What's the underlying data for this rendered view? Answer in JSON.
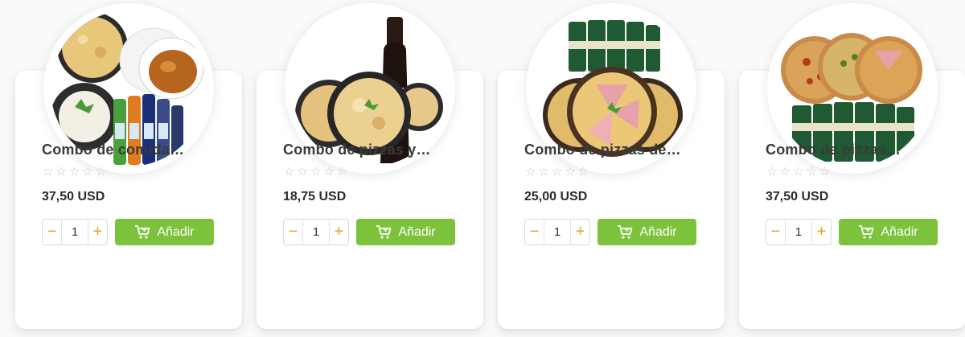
{
  "products": [
    {
      "title": "Combo de comida…",
      "price": "37,50 USD",
      "rating": 0,
      "stars": [
        "☆",
        "☆",
        "☆",
        "☆",
        "☆"
      ],
      "quantity": "1",
      "add_label": "Añadir",
      "decrement_label": "−",
      "increment_label": "+",
      "image_icon": "food-combo-drinks-image"
    },
    {
      "title": "Combo de pizzas y…",
      "price": "18,75 USD",
      "rating": 0,
      "stars": [
        "☆",
        "☆",
        "☆",
        "☆",
        "☆"
      ],
      "quantity": "1",
      "add_label": "Añadir",
      "decrement_label": "−",
      "increment_label": "+",
      "image_icon": "pizzas-wine-image"
    },
    {
      "title": "Combo de pizzas de…",
      "price": "25,00 USD",
      "rating": 0,
      "stars": [
        "☆",
        "☆",
        "☆",
        "☆",
        "☆"
      ],
      "quantity": "1",
      "add_label": "Añadir",
      "decrement_label": "−",
      "increment_label": "+",
      "image_icon": "ham-pizzas-beer-image"
    },
    {
      "title": "Combo de pizzas…",
      "price": "37,50 USD",
      "rating": 0,
      "stars": [
        "☆",
        "☆",
        "☆",
        "☆",
        "☆"
      ],
      "quantity": "1",
      "add_label": "Añadir",
      "decrement_label": "−",
      "increment_label": "+",
      "image_icon": "three-pizzas-beer-image"
    }
  ],
  "colors": {
    "add_button": "#7cc23a",
    "stepper_symbol": "#e0a51d",
    "star_empty": "#c8c8c8",
    "title_text": "#3a3a3a"
  },
  "icons": {
    "cart": "shopping-cart-icon",
    "star": "star-outline-icon"
  }
}
